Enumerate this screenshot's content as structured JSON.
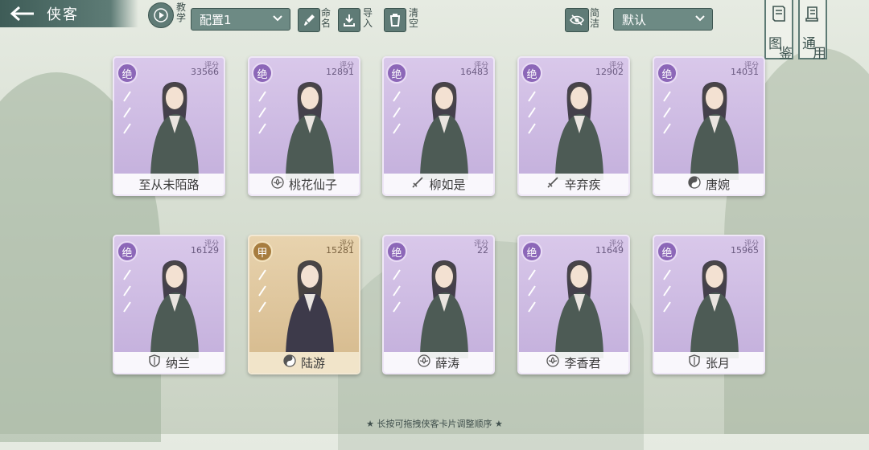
{
  "header": {
    "title": "侠客",
    "teach_label": "教学",
    "preset_value": "配置1",
    "rename_label": "命名",
    "import_label": "导入",
    "clear_label": "清空",
    "simple_label": "简洁",
    "sort_value": "默认",
    "codex_label_1": "图",
    "codex_label_2": "鉴",
    "general_label_1": "通",
    "general_label_2": "用"
  },
  "cards": [
    {
      "rank": "绝",
      "score_label": "评分",
      "score": "33566",
      "name": "至从未陌路",
      "icon": "none",
      "tier": "purple"
    },
    {
      "rank": "绝",
      "score_label": "评分",
      "score": "12891",
      "name": "桃花仙子",
      "icon": "lotus-icon",
      "tier": "purple"
    },
    {
      "rank": "绝",
      "score_label": "评分",
      "score": "16483",
      "name": "柳如是",
      "icon": "sword-icon",
      "tier": "purple"
    },
    {
      "rank": "绝",
      "score_label": "评分",
      "score": "12902",
      "name": "辛弃疾",
      "icon": "sword-icon",
      "tier": "purple"
    },
    {
      "rank": "绝",
      "score_label": "评分",
      "score": "14031",
      "name": "唐婉",
      "icon": "taiji-icon",
      "tier": "purple"
    },
    {
      "rank": "绝",
      "score_label": "评分",
      "score": "16129",
      "name": "纳兰",
      "icon": "shield-icon",
      "tier": "purple"
    },
    {
      "rank": "甲",
      "score_label": "评分",
      "score": "15281",
      "name": "陆游",
      "icon": "taiji-icon",
      "tier": "gold"
    },
    {
      "rank": "绝",
      "score_label": "评分",
      "score": "22",
      "name": "薛涛",
      "icon": "lotus-icon",
      "tier": "purple"
    },
    {
      "rank": "绝",
      "score_label": "评分",
      "score": "11649",
      "name": "李香君",
      "icon": "lotus-icon",
      "tier": "purple"
    },
    {
      "rank": "绝",
      "score_label": "评分",
      "score": "15965",
      "name": "张月",
      "icon": "shield-icon",
      "tier": "purple"
    }
  ],
  "footer": {
    "hint": "★ 长按可拖拽侠客卡片调整顺序 ★"
  },
  "colors": {
    "accent": "#5f7b76",
    "purple": "#8c67b8",
    "gold": "#a77d3f"
  }
}
